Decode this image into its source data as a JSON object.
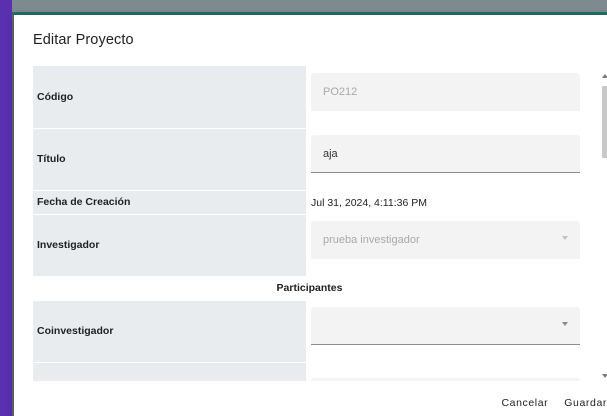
{
  "dialog": {
    "title": "Editar Proyecto"
  },
  "form": {
    "codigo": {
      "label": "Código",
      "value": "PO212"
    },
    "titulo": {
      "label": "Título",
      "value": "aja"
    },
    "fecha": {
      "label": "Fecha de Creación",
      "value": "Jul 31, 2024, 4:11:36 PM"
    },
    "investigador": {
      "label": "Investigador",
      "value": "prueba investigador"
    },
    "section_participantes": "Participantes",
    "coinvestigador": {
      "label": "Coinvestigador",
      "value": ""
    }
  },
  "actions": {
    "cancel_label": "Cancelar",
    "save_label": "Guardar"
  },
  "colors": {
    "accent_left": "#5a2fb0",
    "accent_top": "#1f6f6a",
    "label_bg": "#e9ecef",
    "field_bg": "#f3f3f3"
  }
}
